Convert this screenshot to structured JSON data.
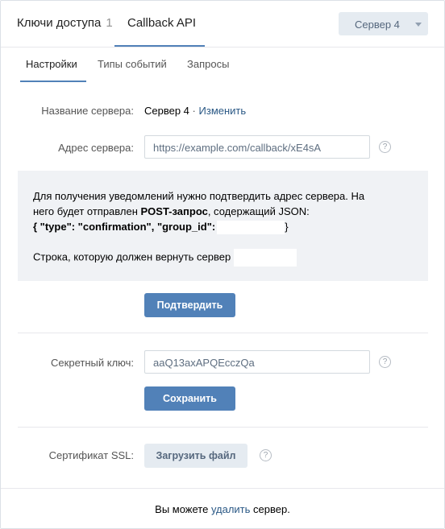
{
  "tabs": {
    "keys": {
      "label": "Ключи доступа",
      "count": "1"
    },
    "callback": {
      "label": "Callback API"
    }
  },
  "server_select": {
    "value": "Сервер 4"
  },
  "subtabs": [
    "Настройки",
    "Типы событий",
    "Запросы"
  ],
  "form": {
    "server_name_label": "Название сервера:",
    "server_name_value": "Сервер 4",
    "separator": "·",
    "change_link": "Изменить",
    "address_label": "Адрес сервера:",
    "address_value": "https://example.com/callback/xE4sA",
    "help_glyph": "?"
  },
  "info": {
    "line1": "Для получения уведомлений нужно подтвердить адрес сервера. На",
    "line2_prefix": "него будет отправлен ",
    "line2_bold": "POST-запрос",
    "line2_suffix": ", содержащий JSON:",
    "json_line": "{ \"type\": \"confirmation\", \"group_id\":",
    "json_close": "}",
    "return_text": "Строка, которую должен вернуть сервер"
  },
  "buttons": {
    "confirm": "Подтвердить",
    "save": "Сохранить",
    "upload": "Загрузить файл"
  },
  "secret": {
    "label": "Секретный ключ:",
    "value": "aaQ13axAPQEcczQa"
  },
  "ssl": {
    "label": "Сертификат SSL:"
  },
  "footer": {
    "prefix": "Вы можете ",
    "link": "удалить",
    "suffix": " сервер."
  },
  "colors": {
    "accent": "#5181b8",
    "link": "#2a5885",
    "info_bg": "#f0f2f5",
    "secondary_btn_bg": "#e5ebf1"
  }
}
